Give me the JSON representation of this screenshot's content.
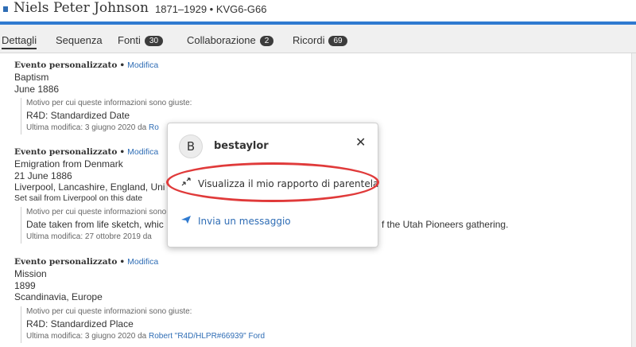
{
  "header": {
    "name": "Niels Peter Johnson",
    "meta": "1871–1929 • KVG6-G66"
  },
  "tabs": [
    {
      "label": "Dettagli",
      "count": null,
      "active": true
    },
    {
      "label": "Sequenza",
      "count": null
    },
    {
      "label": "Fonti",
      "count": "30"
    },
    {
      "label": "Collaborazione",
      "count": "2"
    },
    {
      "label": "Ricordi",
      "count": "69"
    }
  ],
  "events": [
    {
      "type": "Evento personalizzato",
      "edit": "Modifica",
      "lines": [
        "Baptism",
        "June 1886"
      ],
      "reason_label": "Motivo per cui queste informazioni sono giuste:",
      "reason_text": "R4D: Standardized Date",
      "modified": "Ultima modifica: 3 giugno 2020 da",
      "modified_by": "Ro"
    },
    {
      "type": "Evento personalizzato",
      "edit": "Modifica",
      "lines": [
        "Emigration from Denmark",
        "21 June 1886",
        "Liverpool, Lancashire, England, Uni"
      ],
      "note": "Set sail from Liverpool on this date",
      "reason_label": "Motivo per cui queste informazioni sono",
      "reason_text": "Date taken from life sketch, whic",
      "reason_text_tail": "f the Utah Pioneers gathering.",
      "modified": "Ultima modifica: 27 ottobre 2019 da"
    },
    {
      "type": "Evento personalizzato",
      "edit": "Modifica",
      "lines": [
        "Mission",
        "1899",
        "Scandinavia, Europe"
      ],
      "reason_label": "Motivo per cui queste informazioni sono giuste:",
      "reason_text": "R4D: Standardized Place",
      "modified": "Ultima modifica: 3 giugno 2020 da",
      "modified_by": "Robert \"R4D/HLPR#66939\" Ford"
    }
  ],
  "popup": {
    "avatar_letter": "B",
    "username": "bestaylor",
    "close_icon": "✕",
    "relationship_icon": "relationship-icon",
    "relationship_label": "Visualizza il mio rapporto di parentela",
    "message_icon": "send-icon",
    "message_label": "Invia un messaggio"
  },
  "colors": {
    "accent_blue": "#2f7ad0",
    "link_blue": "#2f6db5",
    "highlight_red": "#e03a3a"
  }
}
